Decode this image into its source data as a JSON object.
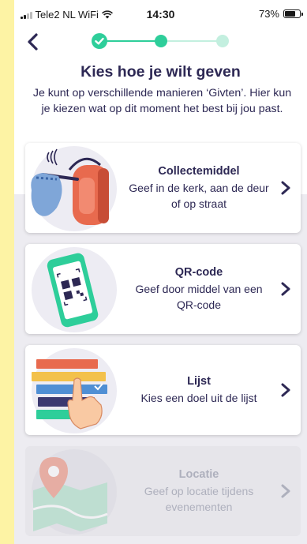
{
  "status_bar": {
    "carrier": "Tele2 NL WiFi",
    "time": "14:30",
    "battery": "73%",
    "battery_level": 0.73
  },
  "header": {
    "title": "Kies hoe je wilt geven",
    "subtitle": "Je kunt op verschillende manieren ‘Givten’. Hier kun je kiezen wat op dit moment het best bij jou past."
  },
  "stepper": {
    "steps": [
      {
        "state": "completed"
      },
      {
        "state": "current"
      },
      {
        "state": "upcoming"
      }
    ],
    "colors": {
      "completed": "#2ece9a",
      "current": "#2ece9a",
      "upcoming": "#c3efdf"
    }
  },
  "options": [
    {
      "title": "Collectemiddel",
      "description": "Geef in de kerk, aan de deur of op straat",
      "icon": "collection-bag-icon",
      "enabled": true
    },
    {
      "title": "QR-code",
      "description": "Geef door middel van een QR-code",
      "icon": "qr-phone-icon",
      "enabled": true
    },
    {
      "title": "Lijst",
      "description": "Kies een doel uit de lijst",
      "icon": "list-hand-icon",
      "enabled": true
    },
    {
      "title": "Locatie",
      "description": "Geef op locatie tijdens evenementen",
      "icon": "map-pin-icon",
      "enabled": false
    }
  ],
  "colors": {
    "text": "#2d2854",
    "accent": "#2ece9a",
    "disabled_text": "#aeb0bd",
    "background": "#edecf1"
  }
}
